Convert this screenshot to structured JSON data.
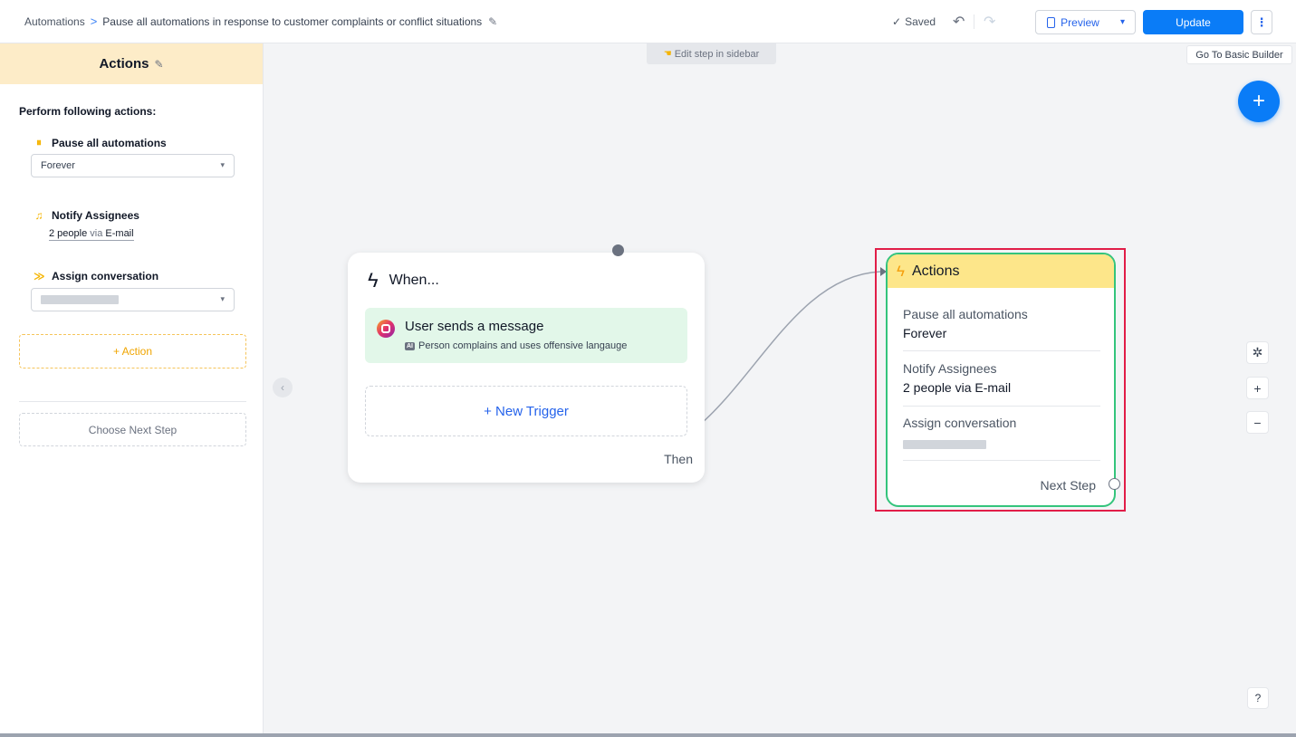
{
  "header": {
    "breadcrumb_root": "Automations",
    "breadcrumb_sep": ">",
    "automation_title": "Pause all automations in response to customer complaints or conflict situations",
    "saved_text": "Saved",
    "preview_label": "Preview",
    "update_label": "Update"
  },
  "sidebar": {
    "title": "Actions",
    "perform_label": "Perform following actions:",
    "actions": [
      {
        "title": "Pause all automations",
        "value": "Forever"
      },
      {
        "title": "Notify Assignees",
        "value_people": "2 people",
        "value_via": "via",
        "value_channel": "E-mail"
      },
      {
        "title": "Assign conversation"
      }
    ],
    "add_action_label": "+ Action",
    "choose_next_label": "Choose Next Step"
  },
  "canvas": {
    "edit_hint": "Edit step in sidebar",
    "basic_builder_label": "Go To Basic Builder",
    "when_card": {
      "title": "When...",
      "trigger_title": "User sends a message",
      "trigger_ai_badge": "AI",
      "trigger_subtitle": "Person complains and uses offensive langauge",
      "new_trigger_label": "+ New Trigger",
      "then_label": "Then"
    },
    "action_card": {
      "title": "Actions",
      "items": [
        {
          "label": "Pause all automations",
          "value": "Forever"
        },
        {
          "label": "Notify Assignees",
          "value": "2 people via E-mail"
        },
        {
          "label": "Assign conversation"
        }
      ],
      "next_step_label": "Next Step"
    }
  },
  "icons": {
    "edit": "pencil-icon",
    "bolt": "lightning-icon",
    "instagram": "instagram-icon",
    "bell": "bell-icon",
    "pause": "pause-icon",
    "assign": "assign-icon"
  },
  "colors": {
    "primary": "#0a7cf7",
    "action_header": "#fde68a",
    "trigger_bg": "#e2f7e9",
    "action_border": "#34c47c",
    "highlight": "#e11d48"
  }
}
